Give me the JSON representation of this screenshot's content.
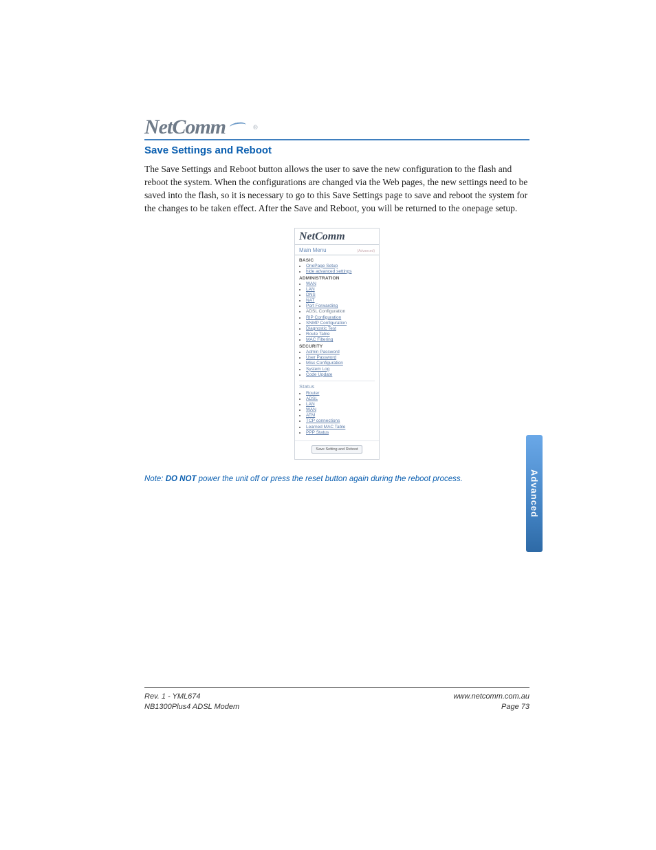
{
  "brand": {
    "name": "NetComm",
    "registered": "®"
  },
  "section": {
    "title": "Save Settings and Reboot",
    "body": "The Save Settings and Reboot button allows the user to save the new configuration to the flash and reboot the system. When the configurations are changed via the Web pages, the new settings need to be saved into the flash, so it is necessary to go to this Save Settings page to save and reboot the system for the changes to be taken effect. After the Save and Reboot, you will be returned to the onepage setup."
  },
  "screenshot": {
    "logo": "NetComm",
    "main_menu_label": "Main Menu",
    "main_menu_sub": "(Advanced)",
    "sections": {
      "basic": {
        "header": "BASIC",
        "items": [
          "OnePage Setup",
          "hide advanced settings"
        ]
      },
      "admin": {
        "header": "ADMINISTRATION",
        "items": [
          "WAN",
          "LAN",
          "DNS",
          "NAT",
          "Port Forwarding",
          "ADSL Configuration",
          "RIP Configuration",
          "SNMP Configuration",
          "Diagnostic Test",
          "Route Table",
          "MAC Filtering"
        ]
      },
      "security": {
        "header": "SECURITY",
        "items": [
          "Admin Password",
          "User Password",
          "Misc Configuration",
          "System Log",
          "Code Update"
        ]
      },
      "status": {
        "header": "Status",
        "items": [
          "Router",
          "ADSL",
          "LAN",
          "WAN",
          "ATM",
          "TCP connections",
          "Learned MAC Table",
          "PPP Status"
        ]
      }
    },
    "button_label": "Save Setting and Reboot"
  },
  "note": {
    "prefix": "Note: ",
    "emph": "DO NOT",
    "rest": " power the unit off or press the reset button again during the reboot process."
  },
  "side_tab": "Advanced",
  "footer": {
    "left1": "Rev. 1 - YML674",
    "left2": "NB1300Plus4  ADSL Modem",
    "right1": "www.netcomm.com.au",
    "right2": "Page 73"
  }
}
